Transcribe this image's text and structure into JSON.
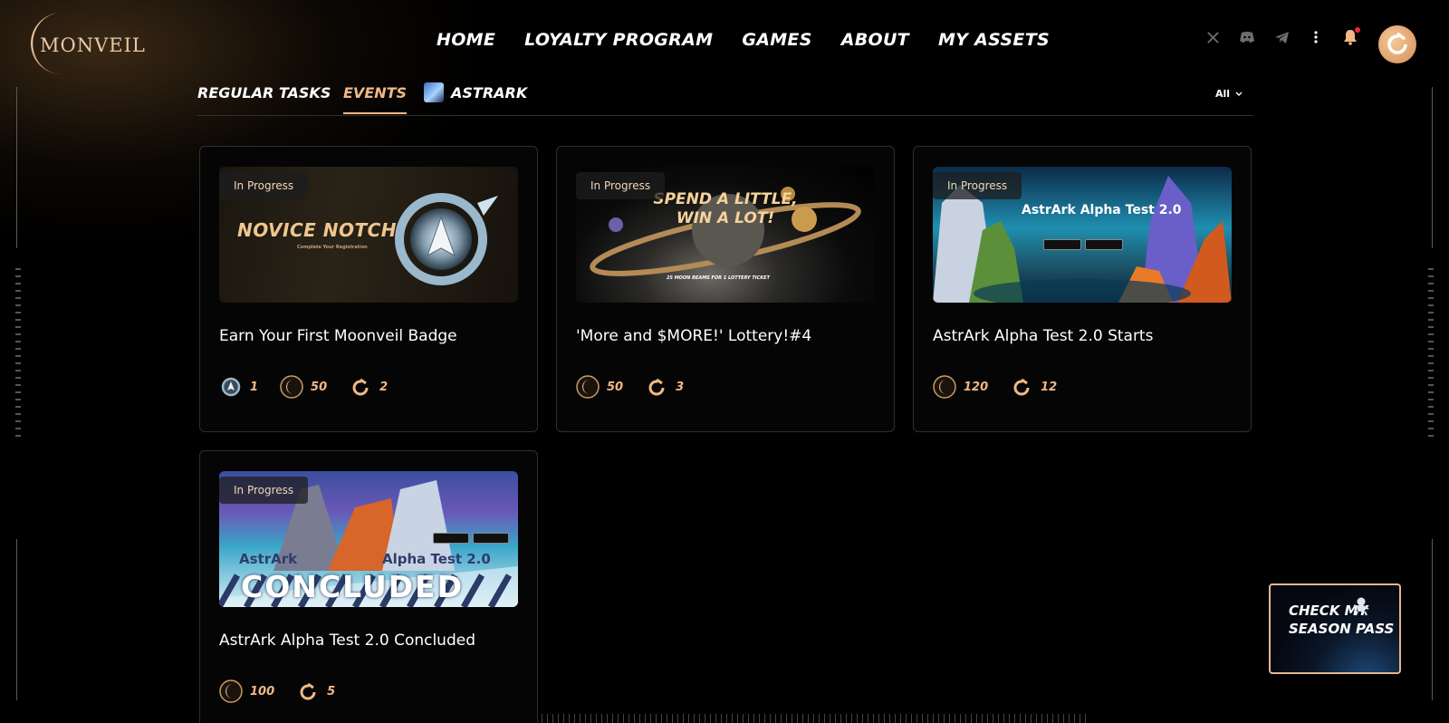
{
  "brand": {
    "name": "MONVEIL",
    "accent": "#f0b887"
  },
  "nav": [
    {
      "label": "HOME"
    },
    {
      "label": "LOYALTY PROGRAM"
    },
    {
      "label": "GAMES"
    },
    {
      "label": "ABOUT"
    },
    {
      "label": "MY ASSETS"
    }
  ],
  "header_icons": [
    "x-icon",
    "discord-icon",
    "telegram-icon",
    "more-icon",
    "bell-icon"
  ],
  "tabs": [
    {
      "label": "REGULAR TASKS",
      "active": false
    },
    {
      "label": "EVENTS",
      "active": true
    },
    {
      "label": "ASTRARK",
      "active": false
    }
  ],
  "filter": {
    "selected": "All"
  },
  "cards": [
    {
      "status": "In Progress",
      "title": "Earn Your First Moonveil Badge",
      "image_text": "NOVICE NOTCH",
      "image_subtext": "Complete Your Registration",
      "rewards": [
        {
          "icon": "badge-icon",
          "value": "1"
        },
        {
          "icon": "moon-beam-icon",
          "value": "50"
        },
        {
          "icon": "season-point-icon",
          "value": "2"
        }
      ]
    },
    {
      "status": "In Progress",
      "title": "'More and $MORE!' Lottery!#4",
      "image_text": "SPEND A LITTLE, WIN A LOT!",
      "image_subtext": "25 MOON BEAMS FOR 1 LOTTERY TICKET",
      "rewards": [
        {
          "icon": "moon-beam-icon",
          "value": "50"
        },
        {
          "icon": "season-point-icon",
          "value": "3"
        }
      ]
    },
    {
      "status": "In Progress",
      "title": "AstrArk Alpha Test 2.0 Starts",
      "image_text": "AstrArk Alpha Test 2.0",
      "rewards": [
        {
          "icon": "moon-beam-icon",
          "value": "120"
        },
        {
          "icon": "season-point-icon",
          "value": "12"
        }
      ]
    },
    {
      "status": "In Progress",
      "title": "AstrArk Alpha Test 2.0 Concluded",
      "image_text": "CONCLUDED",
      "image_subtext_left": "AstrArk",
      "image_subtext_right": "Alpha Test 2.0",
      "rewards": [
        {
          "icon": "moon-beam-icon",
          "value": "100"
        },
        {
          "icon": "season-point-icon",
          "value": "5"
        }
      ]
    }
  ],
  "season_pass": {
    "label": "CHECK MY SEASON PASS"
  }
}
